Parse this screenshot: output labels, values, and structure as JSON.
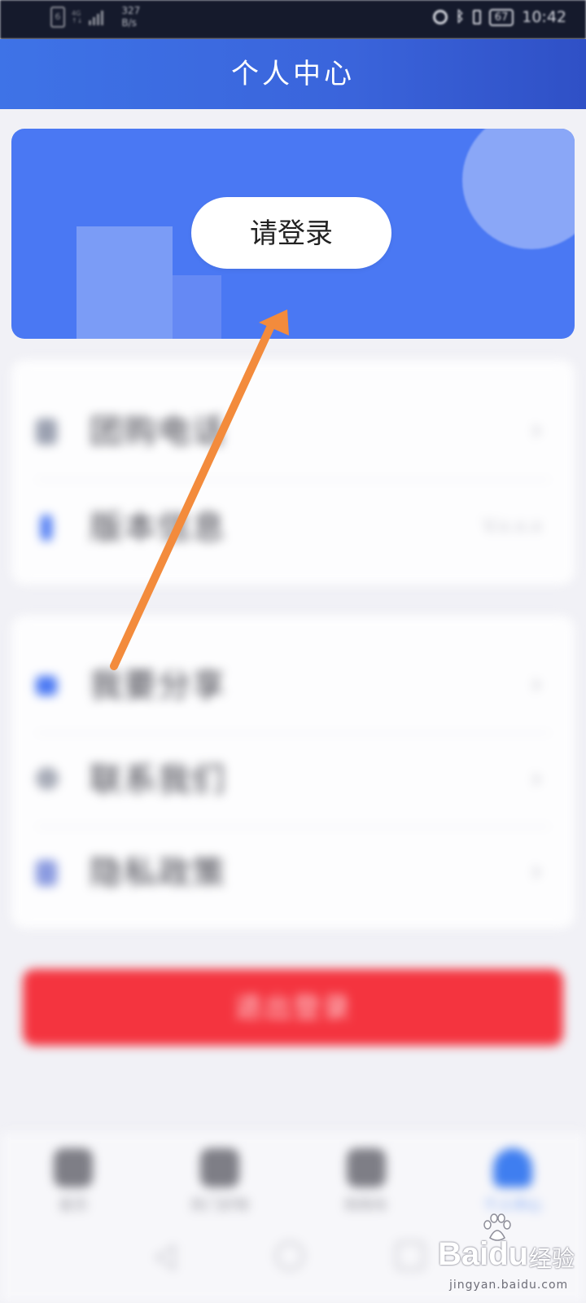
{
  "status_bar": {
    "sim": "6",
    "network": "4G",
    "network_sub": "↑↓",
    "speed_value": "327",
    "speed_unit": "B/s",
    "battery": "67",
    "time": "10:42",
    "icons": [
      "alarm-icon",
      "bluetooth-icon",
      "vibrate-icon",
      "battery-icon"
    ]
  },
  "header": {
    "title": "个人中心"
  },
  "banner": {
    "login_label": "请登录",
    "color": "#4a78f3"
  },
  "menu_card_1": {
    "items": [
      {
        "label": "团购电话",
        "icon": "phone-icon"
      },
      {
        "label": "版本信息",
        "icon": "info-icon",
        "value": "V.x.x.x"
      }
    ]
  },
  "menu_card_2": {
    "items": [
      {
        "label": "我要分享",
        "icon": "share-icon"
      },
      {
        "label": "联系我们",
        "icon": "contact-icon"
      },
      {
        "label": "隐私政策",
        "icon": "privacy-icon"
      }
    ]
  },
  "logout": {
    "label": "退出登录",
    "color": "#f4343f"
  },
  "tab_bar": {
    "items": [
      {
        "label": "首页",
        "icon": "home-icon"
      },
      {
        "label": "热门好物",
        "icon": "shop-icon"
      },
      {
        "label": "购物车",
        "icon": "cart-icon"
      },
      {
        "label": "个人中心",
        "icon": "user-icon",
        "active": true
      }
    ]
  },
  "watermark": {
    "brand": "Bai",
    "brand2": "du",
    "suffix": "经验",
    "url": "jingyan.baidu.com"
  },
  "colors": {
    "header": "#3a64db",
    "arrow": "#f38b3c",
    "accent": "#4a78f3"
  }
}
